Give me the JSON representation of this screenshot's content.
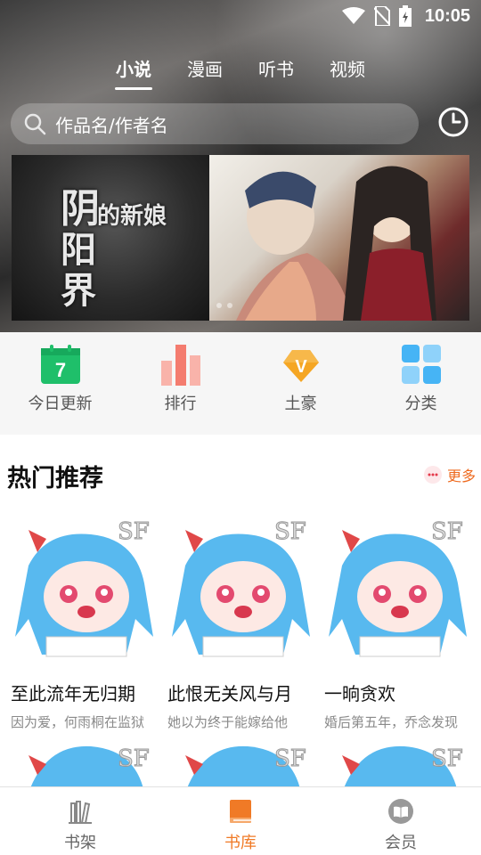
{
  "status": {
    "time": "10:05"
  },
  "tabs": [
    {
      "label": "小说",
      "active": true
    },
    {
      "label": "漫画",
      "active": false
    },
    {
      "label": "听书",
      "active": false
    },
    {
      "label": "视频",
      "active": false
    }
  ],
  "search": {
    "placeholder": "作品名/作者名"
  },
  "banner": {
    "title_chars": [
      "阴",
      "阳",
      "界",
      "的新娘"
    ],
    "dots": 2
  },
  "quicknav": [
    {
      "label": "今日更新",
      "icon": "calendar-icon",
      "badge": "7"
    },
    {
      "label": "排行",
      "icon": "ranking-icon"
    },
    {
      "label": "土豪",
      "icon": "vip-icon",
      "badge": "V"
    },
    {
      "label": "分类",
      "icon": "category-icon"
    }
  ],
  "section": {
    "title": "热门推荐",
    "more": "更多"
  },
  "books": [
    {
      "title": "至此流年无归期",
      "desc": "因为爱，何雨桐在监狱"
    },
    {
      "title": "此恨无关风与月",
      "desc": "她以为终于能嫁给他"
    },
    {
      "title": "一晌贪欢",
      "desc": "婚后第五年，乔念发现"
    }
  ],
  "bottomnav": [
    {
      "label": "书架",
      "icon": "bookshelf-icon",
      "active": false
    },
    {
      "label": "书库",
      "icon": "library-icon",
      "active": true
    },
    {
      "label": "会员",
      "icon": "member-icon",
      "active": false
    }
  ],
  "colors": {
    "accent": "#f07a26",
    "calendar": "#1fbf6a",
    "ranking": "#f47c6f",
    "vip": "#f5a623",
    "category": "#46b4f5"
  }
}
